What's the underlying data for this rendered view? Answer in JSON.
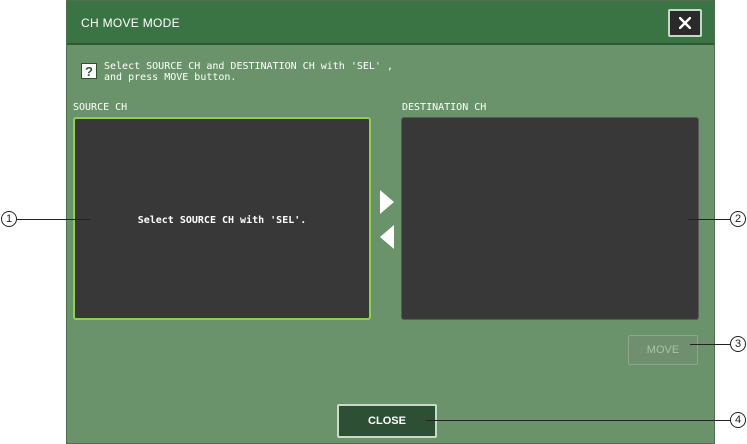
{
  "dialog": {
    "title": "CH MOVE MODE",
    "close_x_label": "×",
    "help_icon": "?",
    "instructions": "Select SOURCE CH and DESTINATION CH with 'SEL' ,\nand press MOVE button.",
    "source_label": "SOURCE CH",
    "destination_label": "DESTINATION CH",
    "source_message": "Select SOURCE CH with 'SEL'.",
    "move_label": "MOVE",
    "close_label": "CLOSE"
  },
  "callouts": [
    "1",
    "2",
    "3",
    "4"
  ],
  "colors": {
    "dialog_bg": "#6b936b",
    "titlebar": "#3a7344",
    "panel_bg": "#383838",
    "source_highlight": "#8fd24a"
  }
}
